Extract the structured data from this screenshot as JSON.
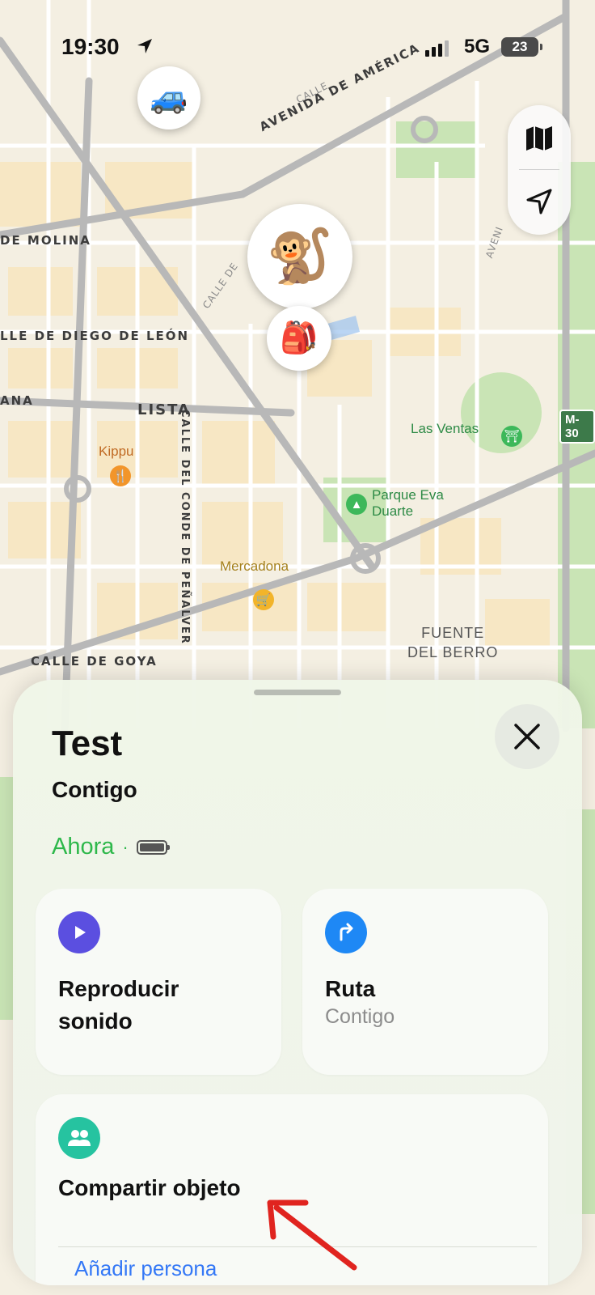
{
  "status_bar": {
    "time": "19:30",
    "network": "5G",
    "battery_level": "23"
  },
  "map": {
    "streets": [
      "AVENIDA DE AMÉRICA",
      "DE MOLINA",
      "LLE DE DIEGO DE LEÓN",
      "ANA",
      "LISTA",
      "CALLE DEL CONDE DE PEÑALVER",
      "CALLE DE GOYA",
      "AVENI",
      "CALLE DE",
      "CALLE",
      "M-30"
    ],
    "places": [
      {
        "name": "Kippu",
        "icon": "fork-knife-icon",
        "color": "#f2952a"
      },
      {
        "name": "Mercadona",
        "icon": "cart-icon",
        "color": "#f2b42a"
      },
      {
        "name": "Las Ventas",
        "icon": "landmark-icon",
        "color": "#3db85a"
      },
      {
        "name": "Parque Eva",
        "name_line2": "Duarte",
        "icon": "tree-icon",
        "color": "#3db85a"
      },
      {
        "name": "FUENTE",
        "name_line2": "DEL BERRO"
      }
    ],
    "markers": {
      "car": "🚙",
      "monkey": "🐒",
      "item": "🎒"
    }
  },
  "sheet": {
    "title": "Test",
    "owner": "Contigo",
    "updated": "Ahora",
    "separator": "·",
    "actions": {
      "play_sound_line1": "Reproducir",
      "play_sound_line2": "sonido",
      "route_label": "Ruta",
      "route_sub": "Contigo",
      "share_label": "Compartir objeto"
    },
    "next_row_peek": "Añadir persona"
  },
  "colors": {
    "accent_green": "#2eb84b",
    "play_purple": "#5b4fe0",
    "route_blue": "#1e88f5",
    "share_teal": "#26c3a0",
    "arrow_red": "#e0241f"
  }
}
